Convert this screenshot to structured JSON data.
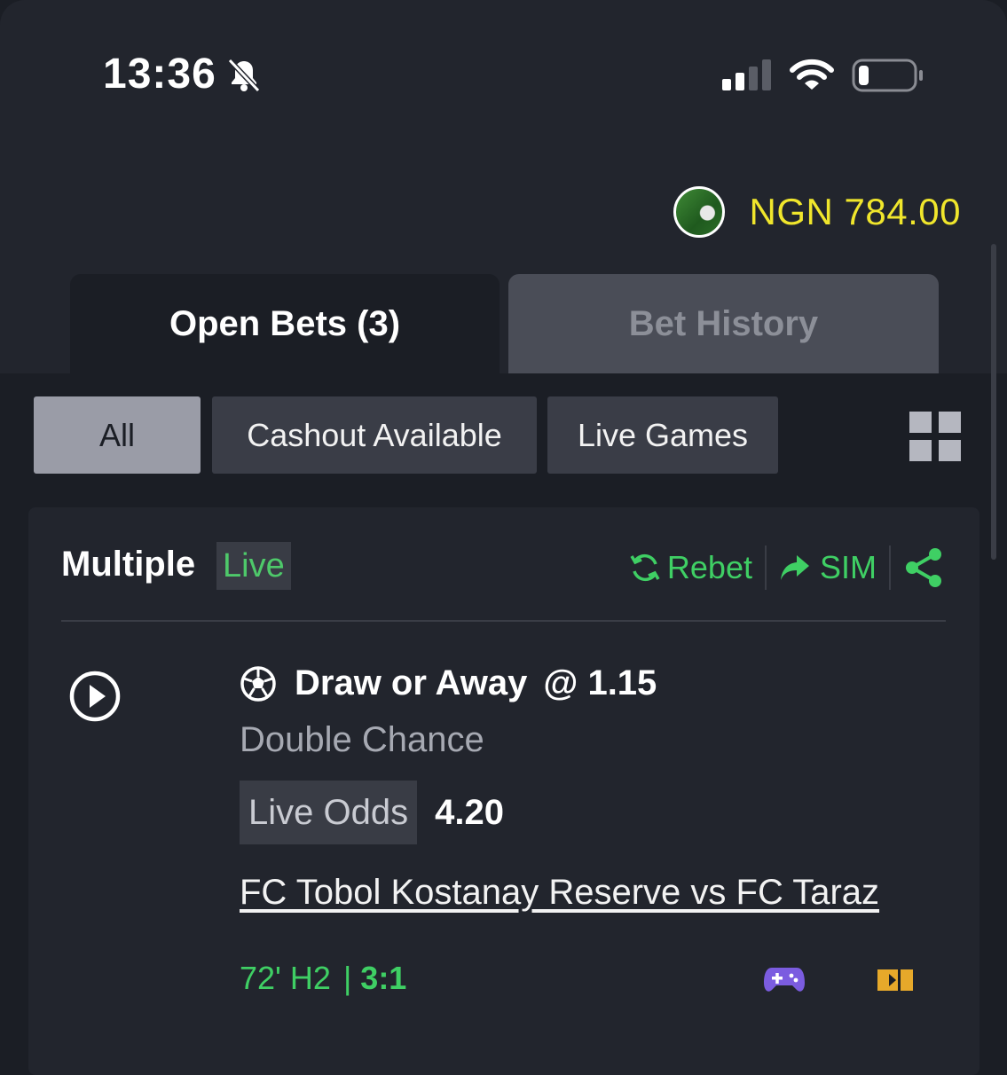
{
  "status": {
    "time": "13:36",
    "icons": [
      "bell-muted-icon",
      "signal-icon",
      "wifi-icon",
      "battery-icon"
    ]
  },
  "header": {
    "avatar_icon": "soccer-avatar",
    "balance": "NGN 784.00",
    "balance_color": "#f0e62c"
  },
  "tabs": [
    {
      "label": "Open Bets (3)",
      "active": true
    },
    {
      "label": "Bet History",
      "active": false
    }
  ],
  "filters": {
    "items": [
      {
        "label": "All",
        "active": true
      },
      {
        "label": "Cashout Available",
        "active": false
      },
      {
        "label": "Live Games",
        "active": false
      }
    ],
    "view_icon": "grid-view-icon"
  },
  "bet": {
    "title": "Multiple",
    "live_label": "Live",
    "actions": {
      "rebet": "Rebet",
      "sim": "SIM",
      "share_icon": "share-icon"
    },
    "selection": {
      "pick": "Draw or Away",
      "at": "@ 1.15",
      "market": "Double Chance",
      "live_odds_label": "Live Odds",
      "live_odds_value": "4.20",
      "match": "FC Tobol Kostanay Reserve vs FC Taraz",
      "minute": "72' H2",
      "separator": "|",
      "score": "3:1"
    }
  },
  "colors": {
    "accent_green": "#3fcf64",
    "background": "#1b1e25",
    "panel": "#22252d"
  }
}
